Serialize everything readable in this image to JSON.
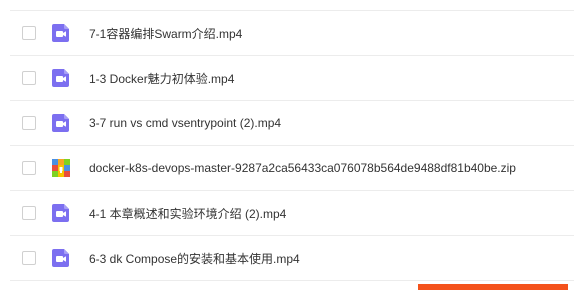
{
  "files": [
    {
      "name": "7-1容器编排Swarm介绍.mp4",
      "type": "video"
    },
    {
      "name": "1-3 Docker魅力初体验.mp4",
      "type": "video"
    },
    {
      "name": "3-7 run vs cmd vsentrypoint (2).mp4",
      "type": "video"
    },
    {
      "name": "docker-k8s-devops-master-9287a2ca56433ca076078b564de9488df81b40be.zip",
      "type": "archive"
    },
    {
      "name": "4-1 本章概述和实验环境介绍 (2).mp4",
      "type": "video"
    },
    {
      "name": "6-3 dk Compose的安装和基本使用.mp4",
      "type": "video"
    }
  ],
  "icons": {
    "video": "video-file-icon",
    "archive": "zip-archive-icon"
  },
  "colors": {
    "video_icon": "#7c6ff0",
    "accent": "#f4521c",
    "text": "#333333",
    "divider": "#ececec"
  }
}
